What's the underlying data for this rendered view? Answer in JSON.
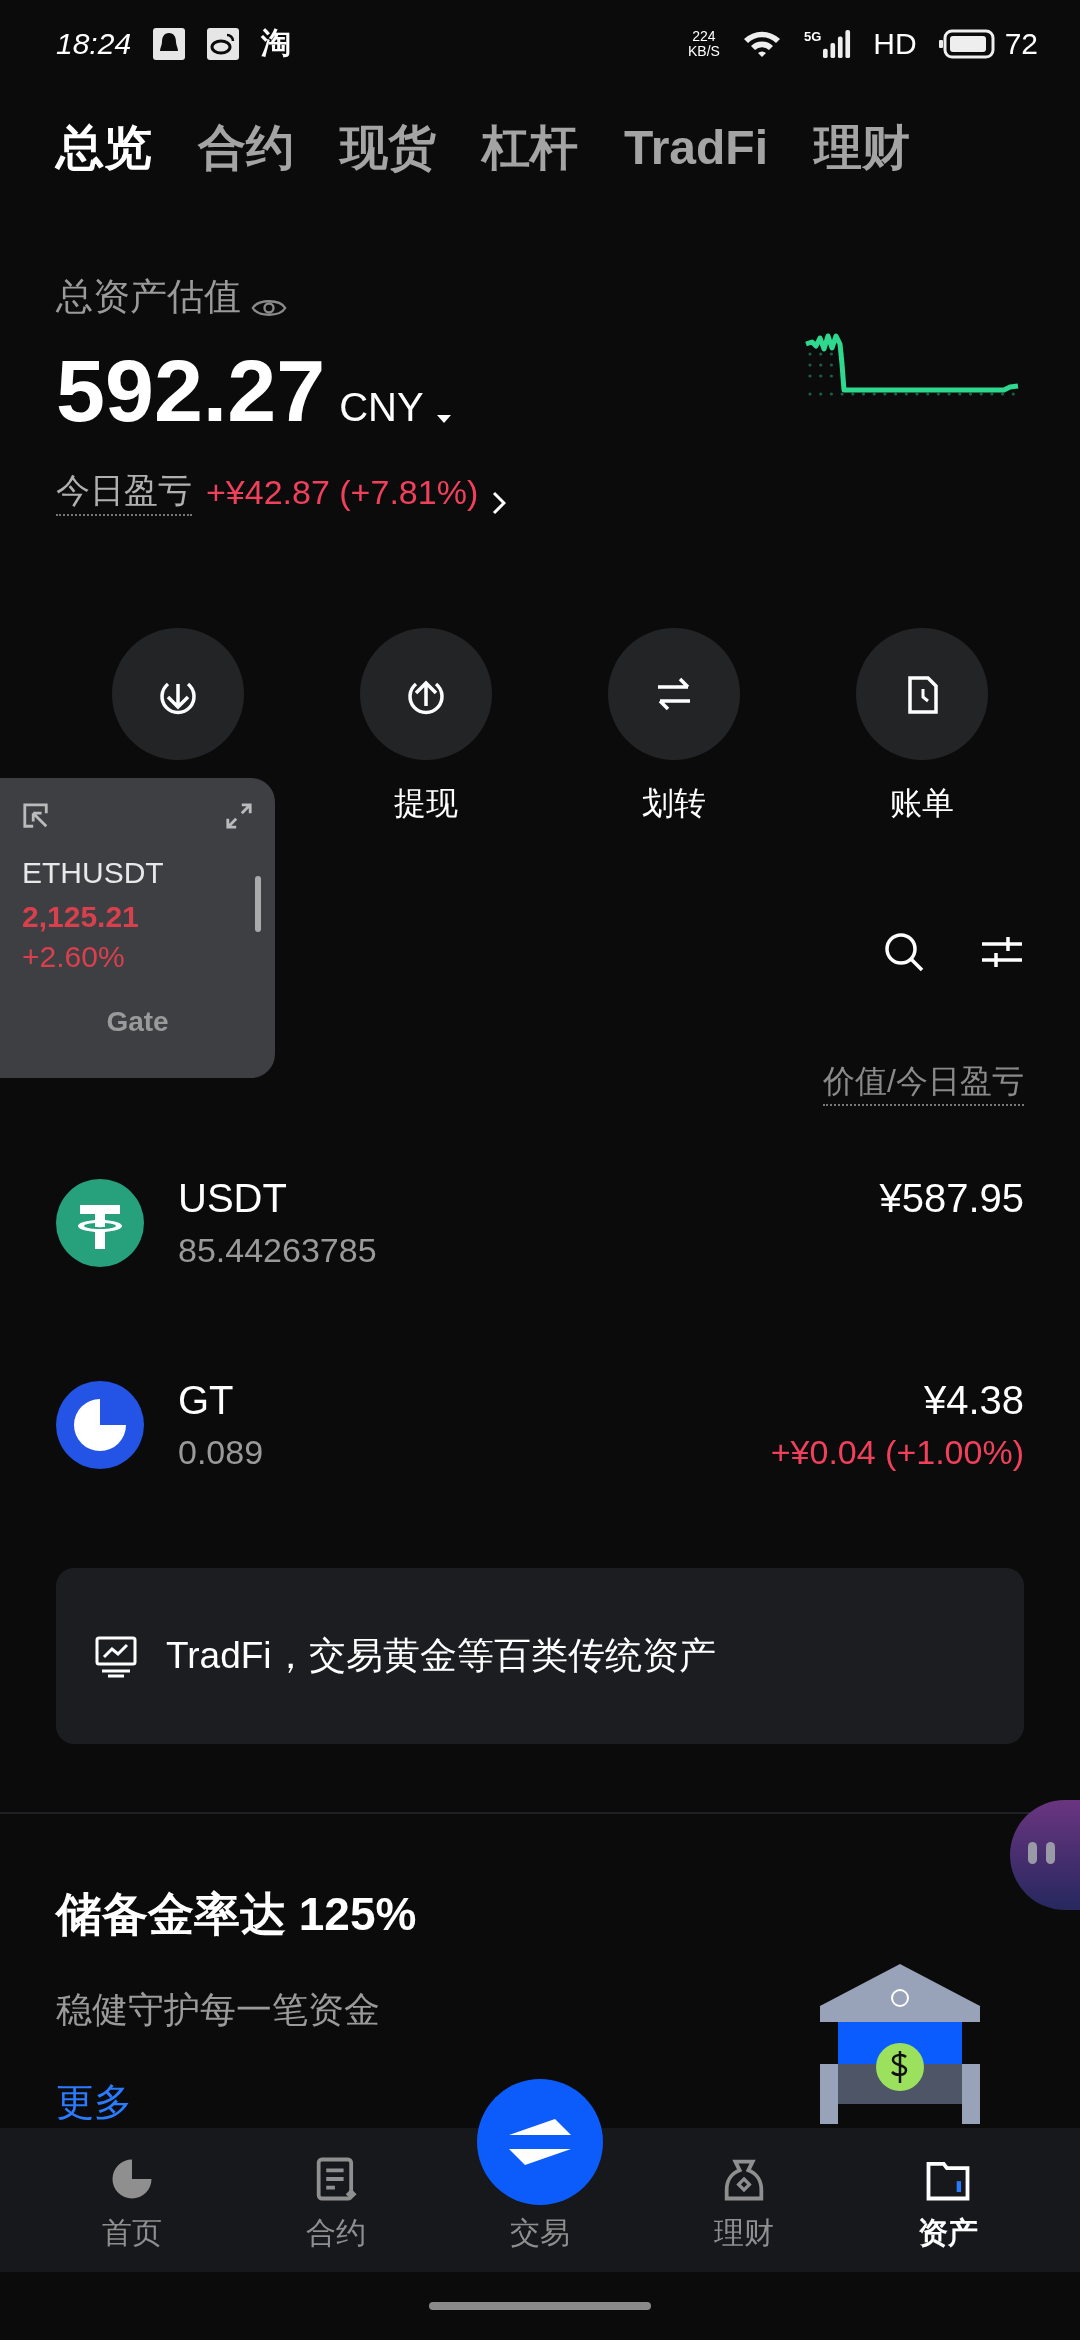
{
  "status_bar": {
    "time": "18:24",
    "app_glyph": "淘",
    "speed": "224",
    "speed_unit": "KB/S",
    "network": "5G",
    "hd": "HD",
    "battery": "72"
  },
  "top_tabs": [
    {
      "label": "总览",
      "selected": true
    },
    {
      "label": "合约",
      "selected": false
    },
    {
      "label": "现货",
      "selected": false
    },
    {
      "label": "杠杆",
      "selected": false
    },
    {
      "label": "TradFi",
      "selected": false
    },
    {
      "label": "理财",
      "selected": false
    }
  ],
  "total": {
    "label": "总资产估值",
    "amount": "592.27",
    "currency": "CNY",
    "pnl_label": "今日盈亏",
    "pnl": "+¥42.87 (+7.81%)"
  },
  "actions": [
    {
      "kind": "deposit"
    },
    {
      "kind": "withdraw",
      "label": "提现"
    },
    {
      "kind": "transfer",
      "label": "划转"
    },
    {
      "kind": "bill",
      "label": "账单"
    }
  ],
  "list_header": {
    "right": "价值/今日盈亏"
  },
  "assets": [
    {
      "kind": "usdt",
      "symbol": "USDT",
      "quantity": "85.44263785",
      "value": "¥587.95"
    },
    {
      "kind": "gt",
      "symbol": "GT",
      "quantity": "0.089",
      "value": "¥4.38",
      "pnl": "+¥0.04 (+1.00%)"
    }
  ],
  "promo_card": {
    "text": "TradFi，交易黄金等百类传统资产"
  },
  "reserve": {
    "title": "储备金率达 125%",
    "subtitle": "稳健守护每一笔资金",
    "link": "更多"
  },
  "floating_ticker": {
    "pair": "ETHUSDT",
    "price": "2,125.21",
    "change": "+2.60%",
    "brand": "Gate"
  },
  "bottom_nav": [
    {
      "kind": "home",
      "label": "首页",
      "selected": false
    },
    {
      "kind": "contract",
      "label": "合约",
      "selected": false
    },
    {
      "kind": "trade",
      "label": "交易",
      "selected": false
    },
    {
      "kind": "earn",
      "label": "理财",
      "selected": false
    },
    {
      "kind": "wallet",
      "label": "资产",
      "selected": true
    }
  ]
}
